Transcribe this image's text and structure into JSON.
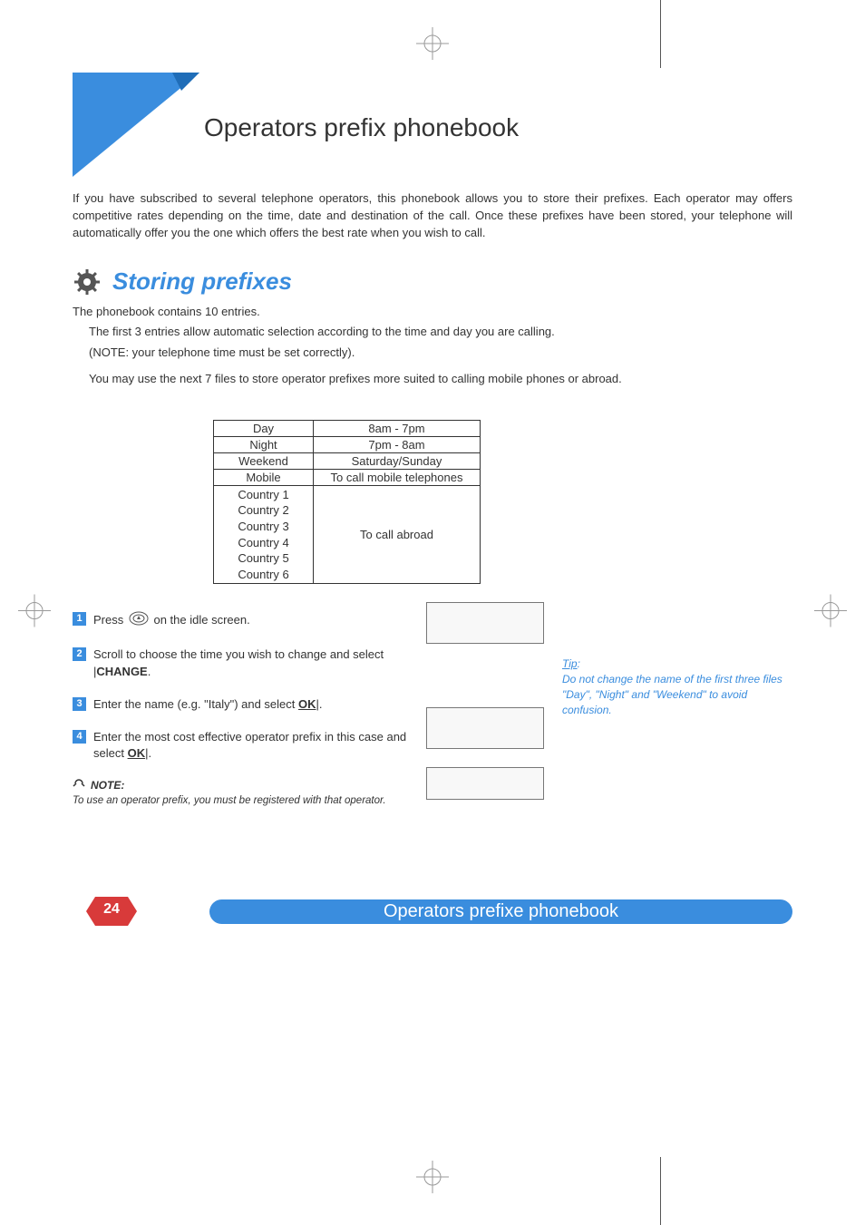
{
  "page_title": "Operators prefix phonebook",
  "intro": "If you have subscribed to several telephone operators, this phonebook allows you to store their prefixes. Each operator may offers competitive rates depending on the time, date and destination of the call. Once these prefixes have been stored, your telephone will automatically offer you the one which offers the best rate when you wish to call.",
  "section_title": "Storing prefixes",
  "body_line1": "The phonebook contains 10 entries.",
  "body_line2": "The first 3 entries allow automatic selection according to the time and day you are calling.",
  "body_line3": "(NOTE: your telephone time must be set correctly).",
  "body_line4": "You may use the next 7 files to store operator prefixes more suited to calling mobile phones or abroad.",
  "table": {
    "rows_simple": [
      {
        "c1": "Day",
        "c2": "8am - 7pm"
      },
      {
        "c1": "Night",
        "c2": "7pm - 8am"
      },
      {
        "c1": "Weekend",
        "c2": "Saturday/Sunday"
      },
      {
        "c1": "Mobile",
        "c2": "To call mobile telephones"
      }
    ],
    "countries": [
      "Country 1",
      "Country 2",
      "Country 3",
      "Country 4",
      "Country 5",
      "Country 6"
    ],
    "countries_c2": "To call abroad"
  },
  "steps": [
    {
      "num": "1",
      "pre": "Press ",
      "post": " on the idle screen."
    },
    {
      "num": "2",
      "text_a": "Scroll to choose the time you wish to change and select |",
      "key": "CHANGE",
      "text_b": "."
    },
    {
      "num": "3",
      "text_a": "Enter the name (e.g. \"Italy\") and select ",
      "key": "OK",
      "text_b": "|."
    },
    {
      "num": "4",
      "text_a": "Enter the most cost effective operator prefix in this case and select ",
      "key": "OK",
      "text_b": "|."
    }
  ],
  "tip": {
    "label": "Tip",
    "colon": ":",
    "text": "Do not change the name of the first three files \"Day\", \"Night\" and \"Weekend\" to avoid confusion."
  },
  "note": {
    "label": "NOTE:",
    "text": "To use an operator prefix, you must be registered with that operator."
  },
  "footer": {
    "page_number": "24",
    "title": "Operators prefixe phonebook"
  }
}
